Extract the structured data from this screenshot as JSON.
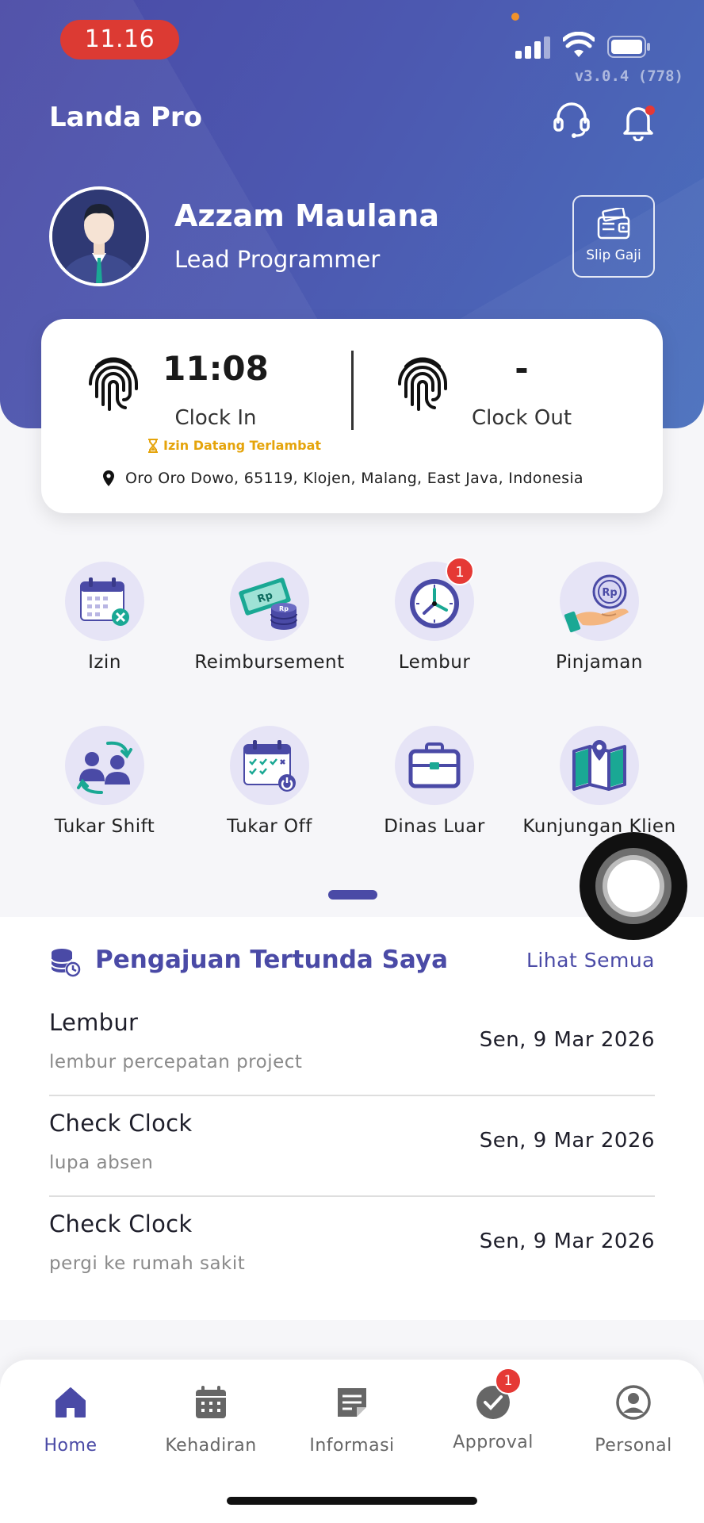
{
  "status_bar": {
    "time": "11.16",
    "version": "v3.0.4 (778)"
  },
  "header": {
    "brand": "Landa Pro"
  },
  "profile": {
    "name": "Azzam Maulana",
    "role": "Lead Programmer",
    "slip_label": "Slip Gaji"
  },
  "attendance": {
    "clock_in_time": "11:08",
    "clock_in_label": "Clock In",
    "clock_out_time": "-",
    "clock_out_label": "Clock Out",
    "late_note": "Izin Datang Terlambat",
    "location": "Oro Oro Dowo, 65119, Klojen, Malang, East Java, Indonesia"
  },
  "menu": [
    {
      "label": "Izin",
      "icon": "calendar-cancel-icon"
    },
    {
      "label": "Reimbursement",
      "icon": "money-coins-icon"
    },
    {
      "label": "Lembur",
      "icon": "clock-icon",
      "badge": "1"
    },
    {
      "label": "Pinjaman",
      "icon": "hand-coin-icon"
    },
    {
      "label": "Tukar Shift",
      "icon": "swap-people-icon"
    },
    {
      "label": "Tukar Off",
      "icon": "calendar-check-icon"
    },
    {
      "label": "Dinas Luar",
      "icon": "briefcase-icon"
    },
    {
      "label": "Kunjungan Klien",
      "icon": "map-pin-icon"
    }
  ],
  "pending": {
    "title": "Pengajuan Tertunda Saya",
    "see_all": "Lihat Semua",
    "items": [
      {
        "title": "Lembur",
        "subtitle": "lembur percepatan project",
        "date": "Sen, 9 Mar 2026"
      },
      {
        "title": "Check Clock",
        "subtitle": "lupa absen",
        "date": "Sen, 9 Mar 2026"
      },
      {
        "title": "Check Clock",
        "subtitle": "pergi ke rumah sakit",
        "date": "Sen, 9 Mar 2026"
      }
    ]
  },
  "nav": [
    {
      "label": "Home",
      "icon": "home-icon",
      "active": true
    },
    {
      "label": "Kehadiran",
      "icon": "calendar-icon"
    },
    {
      "label": "Informasi",
      "icon": "document-icon"
    },
    {
      "label": "Approval",
      "icon": "check-circle-icon",
      "badge": "1"
    },
    {
      "label": "Personal",
      "icon": "user-circle-icon"
    }
  ],
  "colors": {
    "primary": "#4a4aa6",
    "accent_late": "#e5a40b",
    "badge": "#e53935",
    "icon_teal": "#1aa894"
  }
}
